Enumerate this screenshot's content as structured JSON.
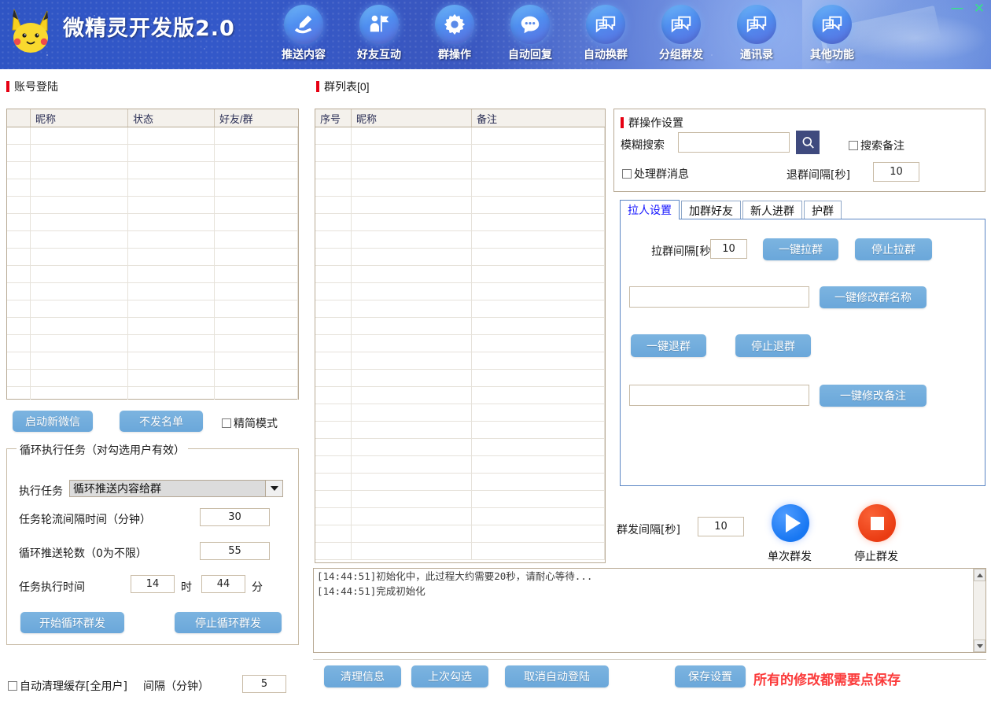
{
  "app": {
    "title": "微精灵开发版2.0",
    "logo": "pikachu-logo",
    "window_buttons": {
      "minimize": "—",
      "close": "✕"
    }
  },
  "nav": {
    "items": [
      {
        "label": "推送内容",
        "icon": "pen-hand-icon"
      },
      {
        "label": "好友互动",
        "icon": "person-flag-icon"
      },
      {
        "label": "群操作",
        "icon": "gear-icon"
      },
      {
        "label": "自动回复",
        "icon": "chat-bubble-icon"
      },
      {
        "label": "自动换群",
        "icon": "double-chat-icon"
      },
      {
        "label": "分组群发",
        "icon": "double-chat-icon"
      },
      {
        "label": "通讯录",
        "icon": "double-chat-icon"
      },
      {
        "label": "其他功能",
        "icon": "double-chat-icon"
      }
    ]
  },
  "account_section": {
    "title": "账号登陆",
    "table": {
      "columns": [
        "",
        "昵称",
        "状态",
        "好友/群"
      ],
      "rows": []
    },
    "buttons": {
      "start_wechat": "启动新微信",
      "no_send_list": "不发名单"
    },
    "simple_mode": {
      "label": "精简模式",
      "checked": false
    }
  },
  "loop_task": {
    "title": "循环执行任务（对勾选用户有效）",
    "task_label": "执行任务",
    "task_value": "循环推送内容给群",
    "interval_label": "任务轮流间隔时间（分钟）",
    "interval_value": "30",
    "rounds_label": "循环推送轮数（0为不限）",
    "rounds_value": "55",
    "time_label": "任务执行时间",
    "time_hour": "14",
    "time_hour_unit": "时",
    "time_minute": "44",
    "time_minute_unit": "分",
    "start_button": "开始循环群发",
    "stop_button": "停止循环群发"
  },
  "auto_clear": {
    "label": "自动清理缓存[全用户]",
    "checked": false,
    "interval_label": "间隔（分钟）",
    "interval_value": "5"
  },
  "group_list": {
    "title": "群列表[0]",
    "columns": [
      "序号",
      "昵称",
      "备注"
    ],
    "rows": []
  },
  "group_settings": {
    "title": "群操作设置",
    "search_label": "模糊搜索",
    "search_value": "",
    "search_placeholder": "",
    "search_icon": "magnifier-icon",
    "search_remark": {
      "label": "搜索备注",
      "checked": false
    },
    "handle_group_msg": {
      "label": "处理群消息",
      "checked": false
    },
    "quit_interval_label": "退群间隔[秒]",
    "quit_interval_value": "10"
  },
  "tabs": [
    {
      "label": "拉人设置",
      "active": true
    },
    {
      "label": "加群好友",
      "active": false
    },
    {
      "label": "新人进群",
      "active": false
    },
    {
      "label": "护群",
      "active": false
    }
  ],
  "pull_settings": {
    "pull_interval_label": "拉群间隔[秒]",
    "pull_interval_value": "10",
    "pull_button": "一键拉群",
    "stop_pull_button": "停止拉群",
    "group_name_value": "",
    "rename_group_button": "一键修改群名称",
    "quit_group_button": "一键退群",
    "stop_quit_button": "停止退群",
    "remark_value": "",
    "modify_remark_button": "一键修改备注"
  },
  "mass_send": {
    "interval_label": "群发间隔[秒]",
    "interval_value": "10",
    "play_label": "单次群发",
    "play_icon": "play-icon",
    "stop_label": "停止群发",
    "stop_icon": "stop-icon"
  },
  "log": {
    "lines": [
      "[14:44:51]初始化中，此过程大约需要20秒，请耐心等待...",
      "[14:44:51]完成初始化"
    ]
  },
  "bottom_bar": {
    "clear_info": "清理信息",
    "last_checked": "上次勾选",
    "cancel_autologin": "取消自动登陆",
    "save_settings": "保存设置",
    "tip": "所有的修改都需要点保存"
  },
  "colors": {
    "header_blue": "#3a57bf",
    "button_blue": "#6aa7da",
    "accent_red": "#e60012",
    "tip_red": "#fb3b3b",
    "active_tab_text": "#1414ff",
    "play_blue": "#1877f2",
    "stop_orange": "#ea3c13"
  }
}
